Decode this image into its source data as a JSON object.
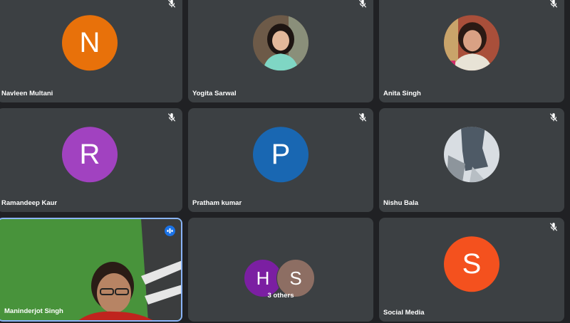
{
  "participants": [
    {
      "name": "Navleen Multani",
      "initial": "N",
      "color": "#e8710a"
    },
    {
      "name": "Yogita Sarwal"
    },
    {
      "name": "Anita Singh"
    },
    {
      "name": "Ramandeep Kaur",
      "initial": "R",
      "color": "#a142c0"
    },
    {
      "name": "Pratham kumar",
      "initial": "P",
      "color": "#1967b2"
    },
    {
      "name": "Nishu Bala"
    },
    {
      "name": "Maninderjot Singh"
    },
    {
      "name": "Social Media",
      "initial": "S",
      "color": "#f4511e"
    }
  ],
  "others": {
    "label": "3 others",
    "avatars": [
      {
        "initial": "H",
        "color": "#7b1fa2"
      },
      {
        "initial": "S",
        "color": "#8d6e63"
      }
    ]
  }
}
